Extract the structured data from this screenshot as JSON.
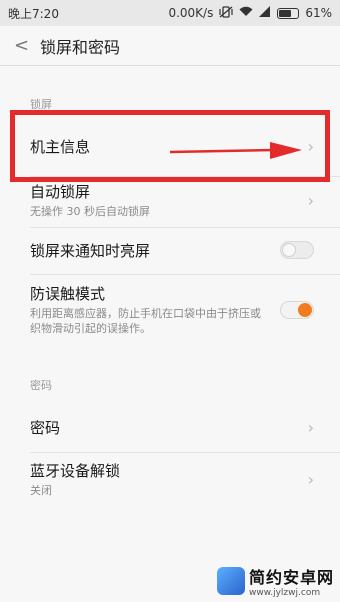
{
  "status_bar": {
    "time": "晚上7:20",
    "network_speed": "0.00K/s",
    "battery": "61%"
  },
  "header": {
    "title": "锁屏和密码"
  },
  "sections": {
    "lock_screen_label": "锁屏",
    "password_label": "密码"
  },
  "items": {
    "owner_info": {
      "label": "机主信息"
    },
    "auto_lock": {
      "label": "自动锁屏",
      "sub": "无操作 30 秒后自动锁屏"
    },
    "notification_wake": {
      "label": "锁屏来通知时亮屏",
      "enabled": false
    },
    "anti_touch": {
      "label": "防误触模式",
      "sub": "利用距离感应器，防止手机在口袋中由于挤压或织物滑动引起的误操作。",
      "enabled": true
    },
    "password": {
      "label": "密码"
    },
    "bluetooth_unlock": {
      "label": "蓝牙设备解锁",
      "sub": "关闭"
    }
  },
  "watermark": {
    "title": "简约安卓网",
    "url": "www.jylzwj.com"
  },
  "colors": {
    "highlight": "#e32b2b",
    "toggle_on": "#f47a1f"
  }
}
